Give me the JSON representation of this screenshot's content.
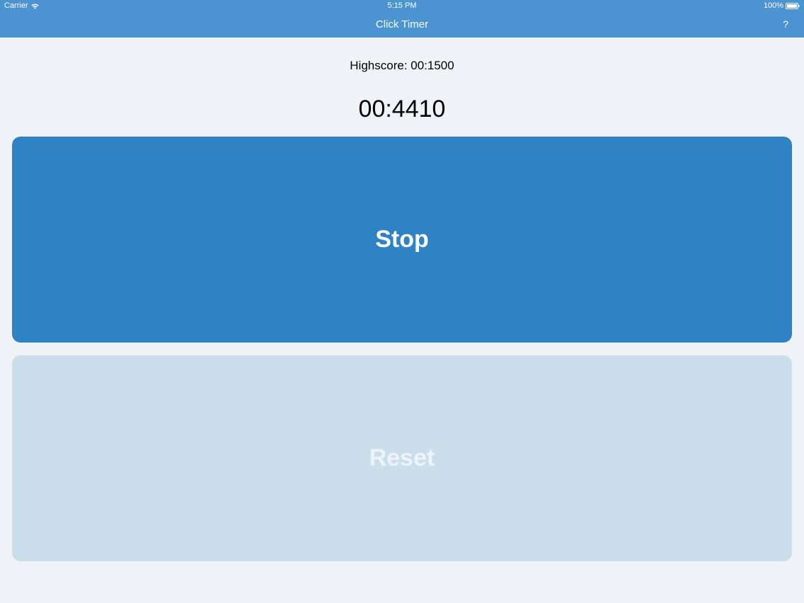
{
  "status_bar": {
    "carrier": "Carrier",
    "time": "5:15 PM",
    "battery": "100%"
  },
  "nav": {
    "title": "Click Timer",
    "help_label": "?"
  },
  "main": {
    "highscore": "Highscore: 00:1500",
    "timer": "00:4410",
    "stop_label": "Stop",
    "reset_label": "Reset"
  },
  "colors": {
    "nav_bar": "#4c93d1",
    "background": "#eff2f6",
    "stop_button": "#2f83c4",
    "reset_button": "#cbdeeb"
  },
  "icons": {
    "wifi": "wifi-icon",
    "battery": "battery-icon"
  }
}
